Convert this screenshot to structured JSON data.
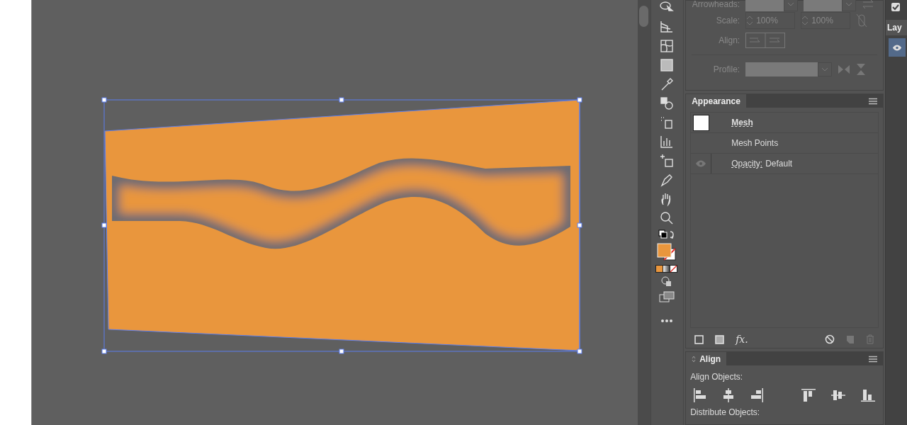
{
  "stroke_panel": {
    "disabled": true,
    "arrowheads_label": "Arrowheads:",
    "scale_label": "Scale:",
    "scale_start": "100%",
    "scale_end": "100%",
    "align_label": "Align:",
    "profile_label": "Profile:"
  },
  "appearance_panel": {
    "title": "Appearance",
    "rows": [
      {
        "kind": "object",
        "label": "Mesh"
      },
      {
        "kind": "sub",
        "label": "Mesh Points"
      },
      {
        "kind": "attribute",
        "label": "Opacity:",
        "value": "Default",
        "visible": true
      }
    ],
    "effect_button": "fx."
  },
  "align_panel": {
    "title": "Align",
    "section": "Align Objects:",
    "next_section": "Distribute Objects:"
  },
  "layers_panel": {
    "tab": "Lay",
    "layer_visible": true,
    "top_checkbox_checked": true
  }
}
